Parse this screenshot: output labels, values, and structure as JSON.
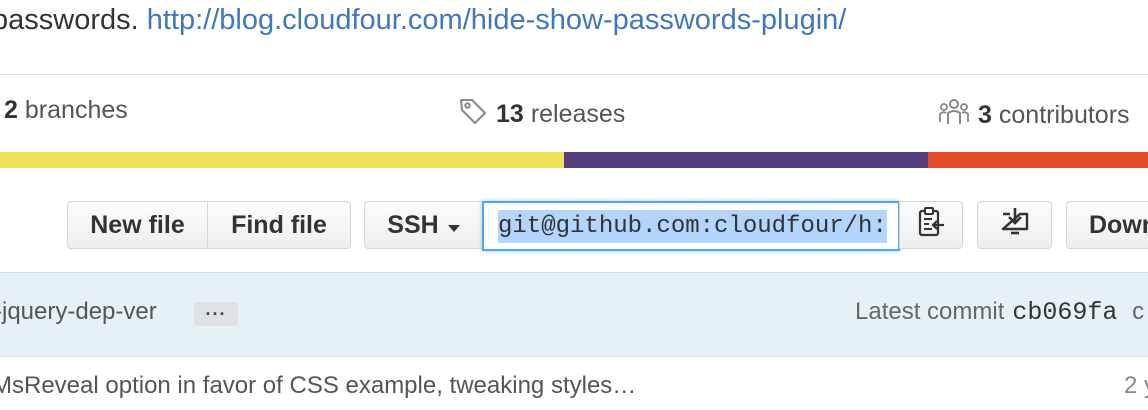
{
  "description": {
    "text": "passwords.",
    "link": "http://blog.cloudfour.com/hide-show-passwords-plugin/"
  },
  "summary": {
    "branches_count": "2",
    "branches_label": "branches",
    "releases_count": "13",
    "releases_label": "releases",
    "contributors_count": "3",
    "contributors_label": "contributors"
  },
  "language_colors": [
    "#f1e05a",
    "#563d7c",
    "#e34c26"
  ],
  "toolbar": {
    "new_file": "New file",
    "find_file": "Find file",
    "protocol": "SSH",
    "clone_url": "git@github.com:cloudfour/h:",
    "download": "Down"
  },
  "commit": {
    "branch": "-jquery-dep-ver",
    "ellipsis": "···",
    "latest_label": "Latest commit",
    "sha": "cb069fa",
    "sha_trailing": "c"
  },
  "file_row": {
    "message": "MsReveal option in favor of CSS example, tweaking styles…",
    "age": "2 y"
  }
}
